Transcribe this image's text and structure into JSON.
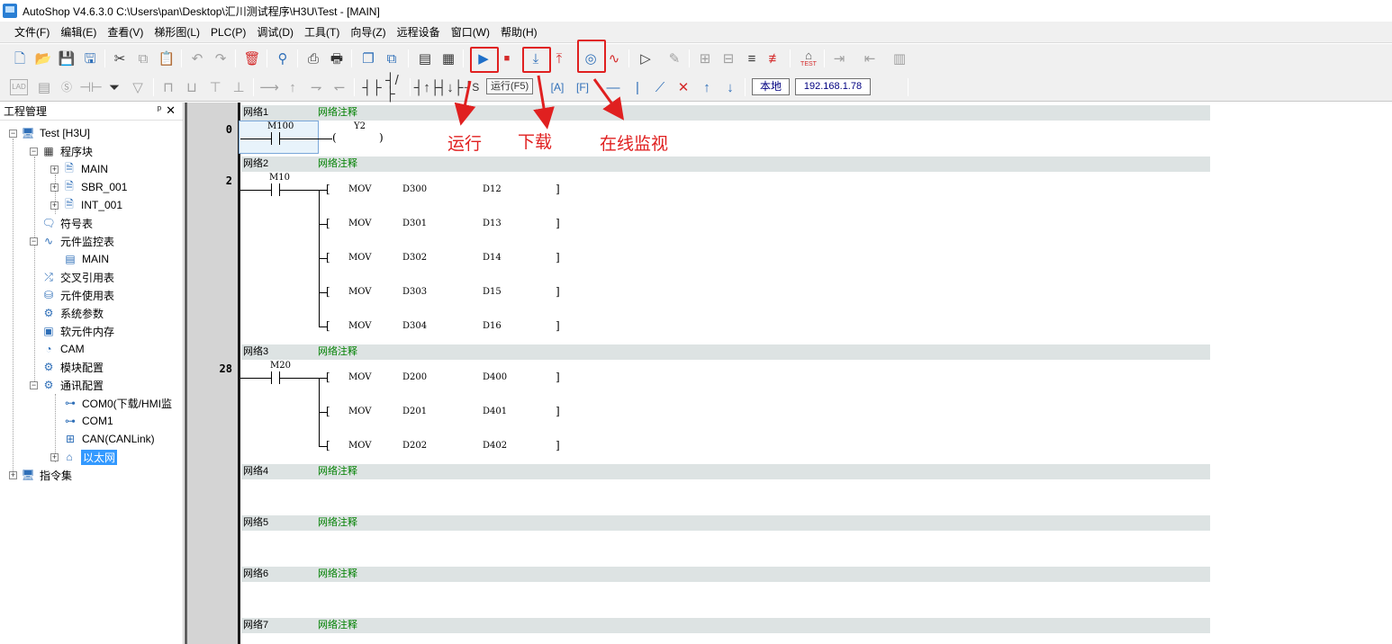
{
  "window": {
    "title": "AutoShop V4.6.3.0  C:\\Users\\pan\\Desktop\\汇川测试程序\\H3U\\Test - [MAIN]"
  },
  "menu": [
    "文件(F)",
    "编辑(E)",
    "查看(V)",
    "梯形图(L)",
    "PLC(P)",
    "调试(D)",
    "工具(T)",
    "向导(Z)",
    "远程设备",
    "窗口(W)",
    "帮助(H)"
  ],
  "toolbar": {
    "tooltip": "运行(F5)",
    "local_label": "本地",
    "ip_address": "192.168.1.78",
    "lad_label": "LAD",
    "test_label": "TEST",
    "accent": "#2f6fb8",
    "highlight": "#e02020"
  },
  "panel": {
    "title": "工程管理",
    "pin": "ᵖ",
    "close": "✕",
    "tree": {
      "root": "Test [H3U]",
      "program_blocks": "程序块",
      "main": "MAIN",
      "sbr": "SBR_001",
      "int": "INT_001",
      "symbols": "符号表",
      "monitor_table": "元件监控表",
      "monitor_main": "MAIN",
      "cross_ref": "交叉引用表",
      "usage_table": "元件使用表",
      "sys_params": "系统参数",
      "soft_memory": "软元件内存",
      "cam": "CAM",
      "module_config": "模块配置",
      "comm_config": "通讯配置",
      "com0": "COM0(下载/HMI监",
      "com1": "COM1",
      "can": "CAN(CANLink)",
      "ethernet": "以太网",
      "instructions": "指令集"
    }
  },
  "networks": [
    {
      "name": "网络1",
      "comment": "网络注释"
    },
    {
      "name": "网络2",
      "comment": "网络注释"
    },
    {
      "name": "网络3",
      "comment": "网络注释"
    },
    {
      "name": "网络4",
      "comment": "网络注释"
    },
    {
      "name": "网络5",
      "comment": "网络注释"
    },
    {
      "name": "网络6",
      "comment": "网络注释"
    },
    {
      "name": "网络7",
      "comment": "网络注释"
    }
  ],
  "ladder": {
    "n1": {
      "step": "0",
      "contact": "M100",
      "coil": "Y2"
    },
    "n2": {
      "step": "2",
      "contact": "M10",
      "rows": [
        {
          "op": "MOV",
          "src": "D300",
          "dst": "D12"
        },
        {
          "op": "MOV",
          "src": "D301",
          "dst": "D13"
        },
        {
          "op": "MOV",
          "src": "D302",
          "dst": "D14"
        },
        {
          "op": "MOV",
          "src": "D303",
          "dst": "D15"
        },
        {
          "op": "MOV",
          "src": "D304",
          "dst": "D16"
        }
      ]
    },
    "n3": {
      "step": "28",
      "contact": "M20",
      "rows": [
        {
          "op": "MOV",
          "src": "D200",
          "dst": "D400"
        },
        {
          "op": "MOV",
          "src": "D201",
          "dst": "D401"
        },
        {
          "op": "MOV",
          "src": "D202",
          "dst": "D402"
        }
      ]
    },
    "bracket_open": "[",
    "bracket_close": "]"
  },
  "annotations": {
    "run": "运行",
    "download": "下载",
    "monitor": "在线监视"
  }
}
